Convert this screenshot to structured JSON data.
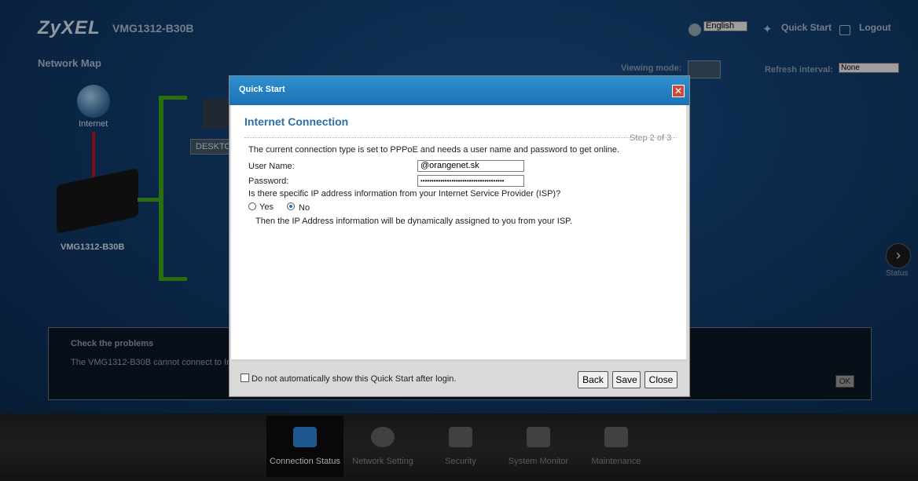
{
  "header": {
    "brand": "ZyXEL",
    "model": "VMG1312-B30B",
    "language": "English",
    "quick_start": "Quick Start",
    "logout": "Logout"
  },
  "network_map": {
    "title": "Network Map",
    "viewing_mode_label": "Viewing mode:",
    "refresh_label": "Refresh interval:",
    "refresh_value": "None",
    "internet_label": "Internet",
    "router_label": "VMG1312-B30B",
    "desktop_label": "DESKTO",
    "status_label": "Status"
  },
  "problems": {
    "title": "Check the problems",
    "text": "The VMG1312-B30B cannot connect to In",
    "ok_label": "OK"
  },
  "tabs": [
    {
      "label": "Connection Status",
      "active": true
    },
    {
      "label": "Network Setting"
    },
    {
      "label": "Security"
    },
    {
      "label": "System Monitor"
    },
    {
      "label": "Maintenance"
    }
  ],
  "modal": {
    "title": "Quick Start",
    "heading": "Internet Connection",
    "step": "Step 2 of 3",
    "intro": "The current connection type is set to PPPoE and needs a user name and password to get online.",
    "username_label": "User Name:",
    "username_value": "@orangenet.sk",
    "password_label": "Password:",
    "password_value": "••••••••••••••••••••••••••••••••••••••",
    "isp_question": "Is there specific IP address information from your Internet Service Provider (ISP)?",
    "yes_label": "Yes",
    "no_label": "No",
    "dynamic_note": "Then the IP Address information will be dynamically assigned to you from your ISP.",
    "dont_show_label": "Do not automatically show this Quick Start after login.",
    "back_label": "Back",
    "save_label": "Save",
    "close_label": "Close"
  }
}
